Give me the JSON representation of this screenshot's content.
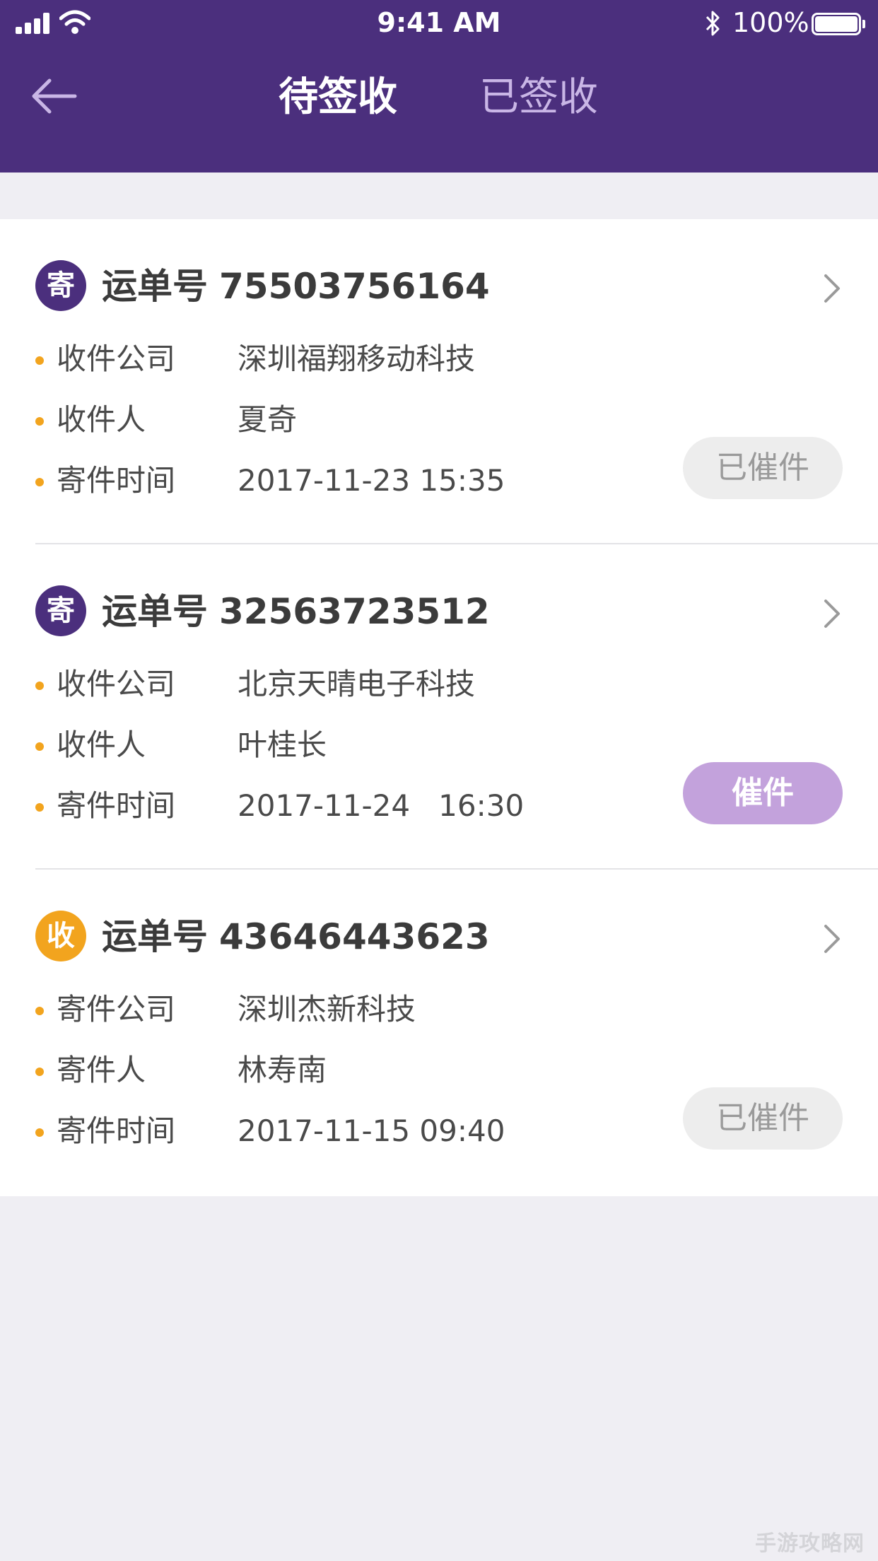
{
  "status_bar": {
    "time": "9:41 AM",
    "battery": "100%",
    "icons": [
      "signal-icon",
      "wifi-icon",
      "bluetooth-icon",
      "battery-icon"
    ]
  },
  "header": {
    "tabs": [
      {
        "label": "待签收",
        "active": true
      },
      {
        "label": "已签收",
        "active": false
      }
    ],
    "back_icon": "back-arrow-icon"
  },
  "colors": {
    "brand": "#4B2F7D",
    "accent_dot": "#F2A41E",
    "urge_button": "#C3A2DC",
    "inactive_tab": "#C9B6E6"
  },
  "orders": [
    {
      "badge": "寄",
      "badge_type": "send",
      "waybill_label": "运单号",
      "waybill_no": "75503756164",
      "fields": [
        {
          "label": "收件公司",
          "value": "深圳福翔移动科技"
        },
        {
          "label": "收件人",
          "value": "夏奇"
        },
        {
          "label": "寄件时间",
          "value": "2017-11-23 15:35"
        }
      ],
      "action": "已催件",
      "action_state": "done"
    },
    {
      "badge": "寄",
      "badge_type": "send",
      "waybill_label": "运单号",
      "waybill_no": "32563723512",
      "fields": [
        {
          "label": "收件公司",
          "value": "北京天晴电子科技"
        },
        {
          "label": "收件人",
          "value": "叶桂长"
        },
        {
          "label": "寄件时间",
          "value": "2017-11-24   16:30"
        }
      ],
      "action": "催件",
      "action_state": "primary"
    },
    {
      "badge": "收",
      "badge_type": "recv",
      "waybill_label": "运单号",
      "waybill_no": "43646443623",
      "fields": [
        {
          "label": "寄件公司",
          "value": "深圳杰新科技"
        },
        {
          "label": "寄件人",
          "value": "林寿南"
        },
        {
          "label": "寄件时间",
          "value": "2017-11-15 09:40"
        }
      ],
      "action": "已催件",
      "action_state": "done"
    }
  ],
  "watermark": "手游攻略网"
}
